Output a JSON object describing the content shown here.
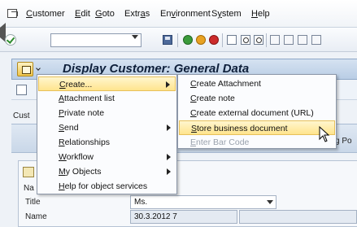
{
  "menubar": {
    "items": [
      "Customer",
      "Edit",
      "Goto",
      "Extras",
      "Environment",
      "System",
      "Help"
    ],
    "underlines": [
      "C",
      "E",
      "G",
      "a",
      "v",
      "y",
      "H"
    ]
  },
  "toolbar": {
    "command_field_value": ""
  },
  "titlebar": {
    "title": "Display Customer: General Data"
  },
  "content": {
    "customer_label_partial": "Cust",
    "tab_partial": "g Po",
    "group_label_partial": "Na",
    "fields": [
      {
        "label": "Title",
        "value": "Ms."
      },
      {
        "label": "Name",
        "value": "30.3.2012 7"
      }
    ]
  },
  "context_menu": {
    "items": [
      {
        "label": "Create...",
        "underline": "C",
        "has_submenu": true,
        "active": true
      },
      {
        "label": "Attachment list",
        "underline": "A",
        "has_submenu": false
      },
      {
        "label": "Private note",
        "underline": "P",
        "has_submenu": false
      },
      {
        "label": "Send",
        "underline": "S",
        "has_submenu": true
      },
      {
        "label": "Relationships",
        "underline": "R",
        "has_submenu": false
      },
      {
        "label": "Workflow",
        "underline": "W",
        "has_submenu": true
      },
      {
        "label": "My Objects",
        "underline": "M",
        "has_submenu": true
      },
      {
        "label": "Help for object services",
        "underline": "H",
        "has_submenu": false
      }
    ]
  },
  "submenu": {
    "items": [
      {
        "label": "Create Attachment",
        "underline": "C"
      },
      {
        "label": "Create note",
        "underline": "C"
      },
      {
        "label": "Create external document (URL)",
        "underline": "C"
      },
      {
        "label": "Store business document",
        "underline": "S",
        "hover": true
      },
      {
        "label": "Enter Bar Code",
        "underline": "E",
        "disabled": true
      }
    ]
  }
}
